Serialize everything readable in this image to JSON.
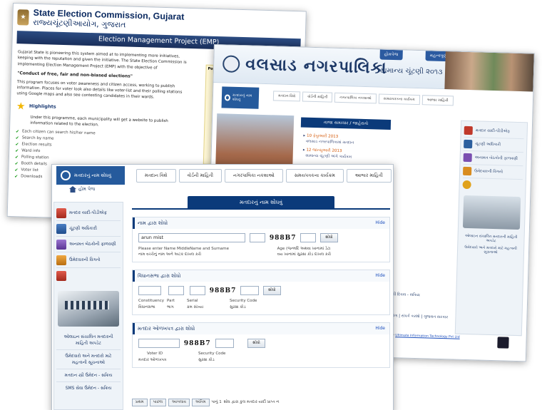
{
  "back": {
    "title_en": "State Election Commission, Gujarat",
    "title_gu": "રાજ્યચૂંટણીઆયોગ, ગુજરાત",
    "bar": "Election Management Project (EMP)",
    "para1": "Gujarat State is pioneering this system aimed at to implementing more initiatives, keeping with the reputation and given the initiative. The State Election Commission is implementing Election Management Project (EMP) with the objective of",
    "quote": "\"Conduct of free, fair and non-biased elections\"",
    "para2": "This program focuses on voter awareness and citizen access, working to publish information. Places for voter look also details like voter-list and their polling stations using Google maps and also see contesting candidates in their wards.",
    "highlights": "Highlights",
    "hl_text": "Under this programme, each municipality will get a website to publish information related to the election.",
    "list": [
      "Each citizen can search his/her name",
      "Search by name",
      "Election results",
      "Ward info",
      "Polling station",
      "Booth details",
      "Voter list",
      "Downloads"
    ],
    "side": "Poll"
  },
  "mid": {
    "brand": "વલસાડ નગરપાલિકા",
    "election": "સામાન્ય ચૂંટણી ૨૦૧૩",
    "tab1": "હોમપેજ",
    "tab2": "મહત્વપૂર્ણ તત્વો",
    "search": "મતદારનું નામ શોધવું",
    "nav": [
      "મતદાન વિશે",
      "વોર્ડની માહિતી",
      "નગરપાલિકા નકશાઓ",
      "સમયપત્રકના કાર્યક્રમ",
      "આભાર માહિતી"
    ],
    "news_title": "તાજા સમાચાર / જાહેરાતો",
    "news": [
      {
        "date": "10 ફેબ્રુઆરી 2013",
        "text": "વલસાડ નગરપાલિકામાં મતદાન"
      },
      {
        "date": "12 જાન્યુઆરી 2013",
        "text": "સામાન્ય ચૂંટણી અંગે કાર્યક્રમ"
      }
    ],
    "sidebar": [
      "મતદાર યાદી-પીડીએફ",
      "ચૂંટણી અધિકારી",
      "અનામત બેઠકોની ફાળવણી",
      "ઉમેદવારની વિગતો"
    ],
    "caption1": "ઓલાઇન સંચાલિત મતદારની માહિતી અપડેટ",
    "caption2": "ઉમેદવારો અને મતદારો માટે મહત્વની સૂચનાઓ",
    "foot1": "ચૂંટણી દિવસ - સક્રિય",
    "foot_links": "આયોગ | સંપર્ક કરશો | ગુજરાત સરકાર",
    "dev_prefix": "Developed by",
    "dev": "Ultimate Information Technology Pvt Ltd"
  },
  "front": {
    "search_tab": "મતદારનું નામ શોધવું",
    "nav": [
      "મતદાન વિશે",
      "વોર્ડની માહિતી",
      "નગરપાલિકા નકશાઓ",
      "સમયપત્રકના કાર્યક્રમ",
      "આભાર માહિતી"
    ],
    "home": "હોમ પેજ",
    "left": [
      "મતદાર યાદી-પીડીએફ",
      "ચૂંટણી અધિકારી",
      "અનામત બેઠકોની ફાળવણી",
      "ઉમેદવારની વિગતો"
    ],
    "left_captions": [
      "ઓલાઇન સંચાલિત મતદારની માહિતી અપડેટ",
      "ઉમેદવારો અને મતદારો માટે મહત્વની સૂચનાઓ",
      "મતદાન સ્ત્રી ઉમેદન - સક્રિય",
      "SMS સેવા ઉમેદન - સક્રિય"
    ],
    "page_title": "મતદારનું નામ શોધવું",
    "hide": "Hide",
    "sec1": {
      "title": "નામ દ્વારા શોધો",
      "name_value": "arun mist",
      "captcha": "988B7",
      "btn": "શોધો",
      "hint_en": "Please enter Name MiddleName and Surname",
      "hint_gu": "નામ વચ્ચેનું નામ અને અટક દાખલ કરો",
      "age_en": "Age  (જન્મદિ અથવા ખાનામાં ડેટા",
      "age_gu": "વય   ખાનામાં સુરક્ષા કોડ દાખલ કરો"
    },
    "sec2": {
      "title": "વિધાનસભા દ્વારા શોધો",
      "captcha": "988B7",
      "btn": "શોધો",
      "labels_en": [
        "Constituency",
        "Part",
        "Serial",
        "Security Code"
      ],
      "labels_gu": [
        "વિધાનસભા",
        "ભાગ",
        "ક્રમ સંખ્યા",
        "સુરક્ષા કોડ"
      ]
    },
    "sec3": {
      "title": "મતદાર ઓળખપત્ર દ્વારા શોધો",
      "captcha": "988B7",
      "btn": "શોધો",
      "labels_en": [
        "Voter ID",
        "Security Code"
      ],
      "labels_gu": [
        "મતદાર ઓળખપત્ર",
        "સુરક્ષા કોડ"
      ]
    },
    "pager": {
      "first": "પ્રથમ",
      "prev": "પાછલ",
      "next": "આગલાવ",
      "last": "અંતિમ",
      "page": "પાનું 1",
      "note": "શોધ દ્વારા કુલ મતદાર યાદી પ્રાપ્ત ન"
    }
  },
  "colors": {
    "navy": "#0b3a7a",
    "accent": "#255a9c",
    "link": "#1d4fbd",
    "captcha": "#111111"
  }
}
